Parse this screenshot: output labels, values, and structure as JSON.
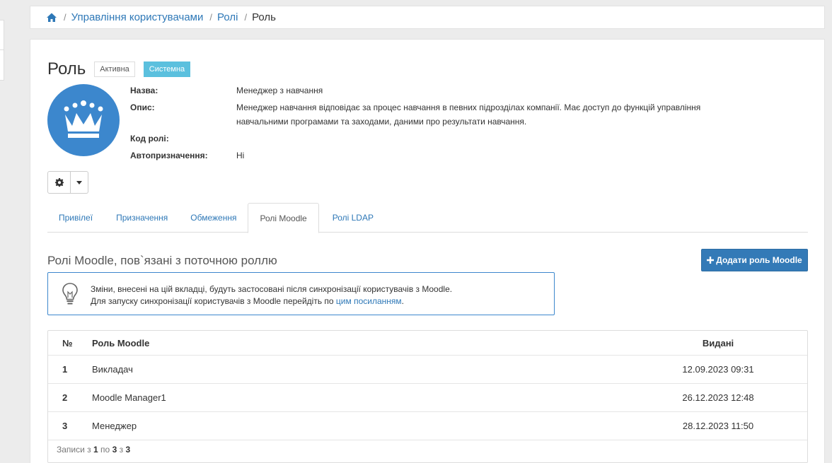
{
  "breadcrumb": {
    "items": [
      "Управління користувачами",
      "Ролі"
    ],
    "current": "Роль"
  },
  "role": {
    "title": "Роль",
    "badge_status": "Активна",
    "badge_type": "Системна",
    "fields": [
      {
        "label": "Назва:",
        "value": "Менеджер з навчання"
      },
      {
        "label": "Опис:",
        "value": "Менеджер навчання відповідає за процес навчання в певних підрозділах компанії. Має доступ до функцій управління навчальними програмами та заходами, даними про результати навчання."
      },
      {
        "label": "Код ролі:",
        "value": ""
      },
      {
        "label": "Автопризначення:",
        "value": "Ні"
      }
    ]
  },
  "tabs": [
    "Привілеї",
    "Призначення",
    "Обмеження",
    "Ролі Moodle",
    "Ролі LDAP"
  ],
  "active_tab": "Ролі Moodle",
  "section": {
    "title": "Ролі Moodle, пов`язані з поточною роллю",
    "add_button": "Додати роль Moodle"
  },
  "alert": {
    "line1": "Зміни, внесені на цій вкладці, будуть застосовані після синхронізації користувачів з Moodle.",
    "line2_prefix": "Для запуску синхронізації користувачів з Moodle перейдіть по ",
    "link": "цим посиланням",
    "line2_suffix": "."
  },
  "table": {
    "headers": [
      "№",
      "Роль Moodle",
      "Видані"
    ],
    "rows": [
      {
        "num": "1",
        "role": "Викладач",
        "issued": "12.09.2023 09:31"
      },
      {
        "num": "2",
        "role": "Moodle Manager1",
        "issued": "26.12.2023 12:48"
      },
      {
        "num": "3",
        "role": "Менеджер",
        "issued": "28.12.2023 11:50"
      }
    ],
    "footer": {
      "prefix": "Записи з",
      "from": "1",
      "mid1": "по",
      "to": "3",
      "mid2": "з",
      "total": "3"
    }
  },
  "colors": {
    "primary": "#337ab7",
    "info": "#5bc0de",
    "avatar": "#3c87cd"
  },
  "icons": [
    "home-icon",
    "crown-icon",
    "gear-icon",
    "caret-down-icon",
    "plus-icon",
    "lightbulb-icon"
  ]
}
